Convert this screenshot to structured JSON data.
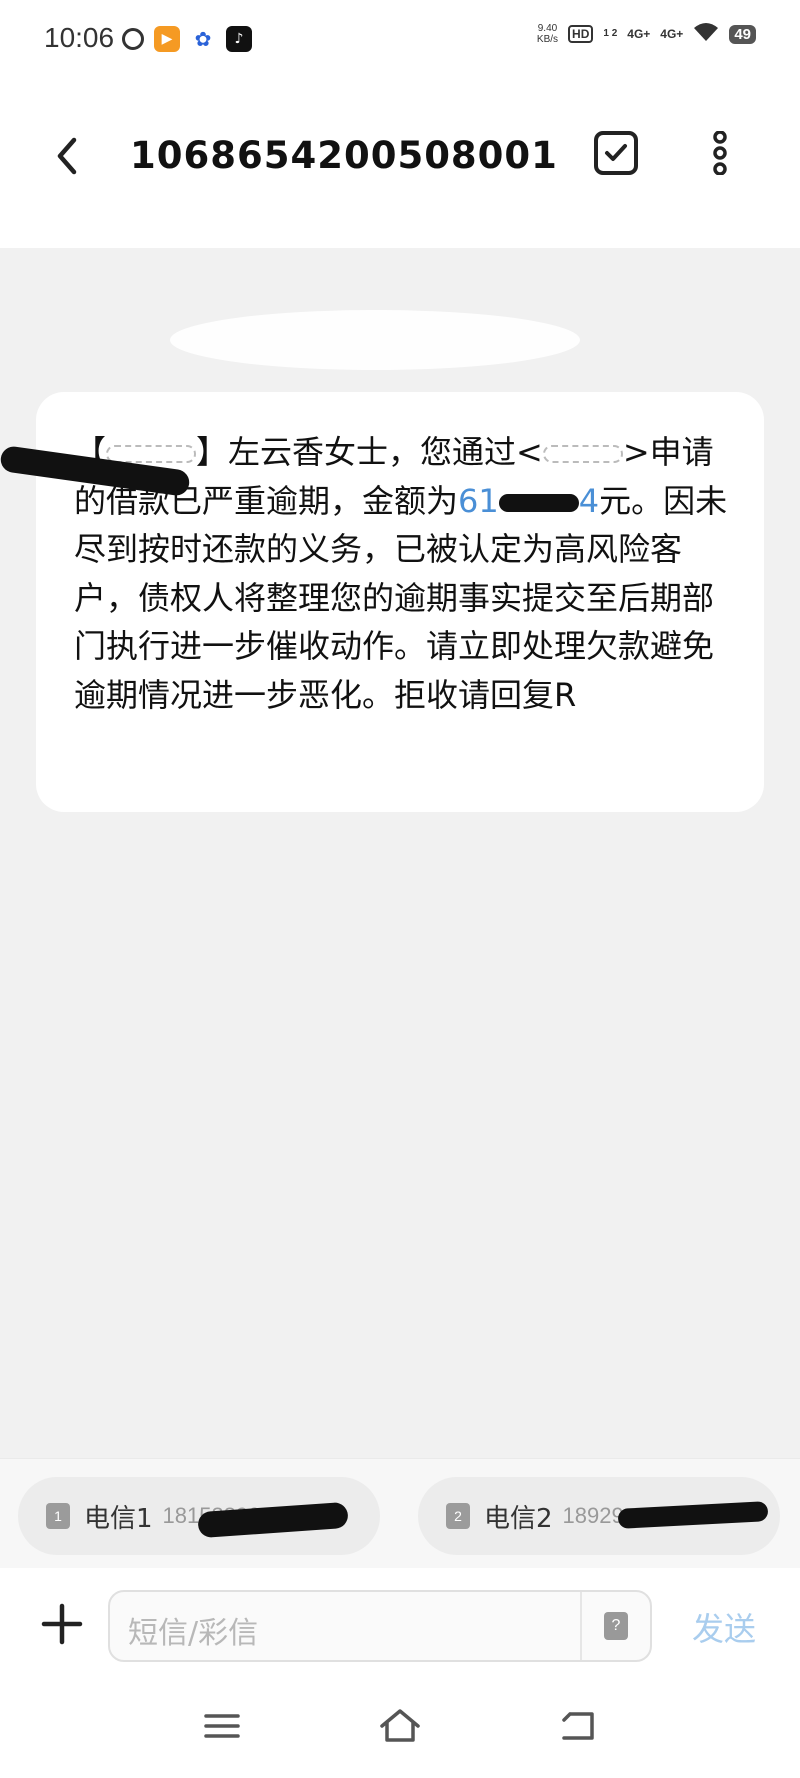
{
  "status_bar": {
    "time": "10:06",
    "net_speed_value": "9.40",
    "net_speed_unit": "KB/s",
    "hd": "HD",
    "sim_indicator": "1 2",
    "signal1": "4G+",
    "signal2": "4G+",
    "battery": "49"
  },
  "header": {
    "title": "1068654200508001",
    "back_icon": "back-arrow-icon",
    "select_icon": "checkbox-icon",
    "more_icon": "more-vertical-icon"
  },
  "message": {
    "part1": "【",
    "part2": "】左云香女士，您通过<",
    "part3": ">申请的借款已严重逾期，金额为",
    "amount_prefix": "61",
    "amount_suffix": "4",
    "part4": "元。因未尽到按时还款的义务，已被认定为高风险客户，债权人将整理您的逾期事实提交至后期部门执行进一步催收动作。请立即处理欠款避免逾期情况进一步恶化。拒收请回复R"
  },
  "sims": [
    {
      "num": "1",
      "label": "电信1",
      "phone": "18153390"
    },
    {
      "num": "2",
      "label": "电信2",
      "phone": "18929"
    }
  ],
  "input": {
    "placeholder": "短信/彩信",
    "mms_icon": "?",
    "send_label": "发送"
  },
  "nav": {
    "menu_icon": "menu-icon",
    "home_icon": "home-icon",
    "back_icon": "nav-back-icon"
  },
  "colors": {
    "chat_bg": "#f1f1f1",
    "link": "#4a8fd6",
    "send": "#a9cdee"
  }
}
